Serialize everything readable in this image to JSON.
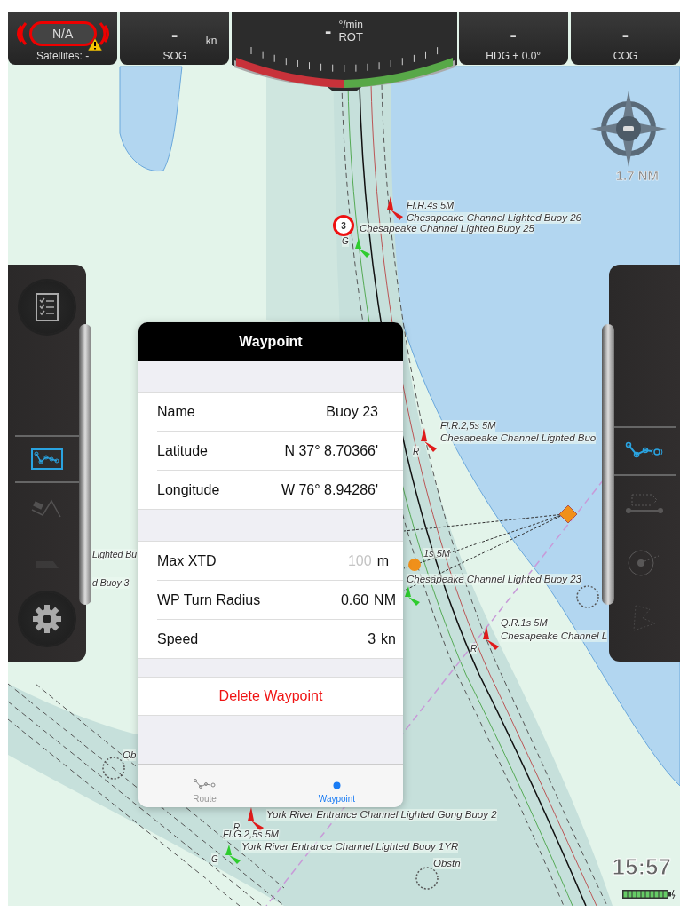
{
  "instruments": [
    {
      "kind": "gps",
      "value": "N/A",
      "label": "Satellites: -",
      "warning": true
    },
    {
      "kind": "readout",
      "value": "-",
      "unit": "kn",
      "label": "SOG"
    },
    {
      "kind": "gauge",
      "value": "-",
      "unit": "°/min",
      "label": "ROT"
    },
    {
      "kind": "readout",
      "value": "-",
      "label": "HDG + 0.0°"
    },
    {
      "kind": "readout",
      "value": "-",
      "label": "COG"
    }
  ],
  "scale": "1.7 NM",
  "chart_labels": [
    {
      "kind": "light",
      "text": "Fl.R.4s 5M"
    },
    {
      "kind": "name",
      "text": "Chesapeake Channel Lighted Buoy 26"
    },
    {
      "kind": "name",
      "text": "Chesapeake Channel Lighted Buoy 25"
    },
    {
      "kind": "letter",
      "text": "G"
    },
    {
      "kind": "light",
      "text": "Fl.R.2,5s 5M"
    },
    {
      "kind": "name",
      "text": "Chesapeake Channel Lighted Buo"
    },
    {
      "kind": "letter",
      "text": "R"
    },
    {
      "kind": "light",
      "text": "1s 5M"
    },
    {
      "kind": "name",
      "text": "Chesapeake Channel Lighted Buoy 23"
    },
    {
      "kind": "light",
      "text": "Q.R.1s 5M"
    },
    {
      "kind": "name",
      "text": "Chesapeake Channel L"
    },
    {
      "kind": "letter",
      "text": "R"
    },
    {
      "kind": "name",
      "text": "Lighted Bu"
    },
    {
      "kind": "name",
      "text": "d Buoy 3"
    },
    {
      "kind": "name",
      "text": "Ob"
    },
    {
      "kind": "name",
      "text": "York River Entrance Channel Lighted Gong Buoy 2"
    },
    {
      "kind": "letter",
      "text": "R"
    },
    {
      "kind": "light",
      "text": "Fl.G.2,5s 5M"
    },
    {
      "kind": "name",
      "text": "York River Entrance Channel Lighted Buoy 1YR"
    },
    {
      "kind": "letter",
      "text": "G"
    },
    {
      "kind": "name",
      "text": "Obstn"
    }
  ],
  "route_marker": "3",
  "left_tools": [
    {
      "kind": "route",
      "selected": true
    },
    {
      "kind": "edit-route",
      "selected": false
    },
    {
      "kind": "tide",
      "selected": false
    }
  ],
  "right_tools": [
    {
      "kind": "route-next",
      "selected": true
    },
    {
      "kind": "boat",
      "selected": false
    },
    {
      "kind": "target",
      "selected": false
    },
    {
      "kind": "constellation",
      "selected": false
    }
  ],
  "popover": {
    "title": "Waypoint",
    "sections": [
      [
        {
          "label": "Name",
          "value": "Buoy 23"
        },
        {
          "label": "Latitude",
          "value": "N 37° 8.70366'"
        },
        {
          "label": "Longitude",
          "value": "W 76° 8.94286'"
        }
      ],
      [
        {
          "label": "Max XTD",
          "placeholder": "100",
          "unit": "m"
        },
        {
          "label": "WP Turn Radius",
          "value": "0.60",
          "unit": "NM"
        },
        {
          "label": "Speed",
          "value": "3",
          "unit": "kn"
        }
      ]
    ],
    "action": "Delete Waypoint",
    "tabs": [
      {
        "kind": "route",
        "label": "Route",
        "selected": false
      },
      {
        "kind": "dot",
        "label": "Waypoint",
        "selected": true
      }
    ]
  },
  "clock": "15:57"
}
